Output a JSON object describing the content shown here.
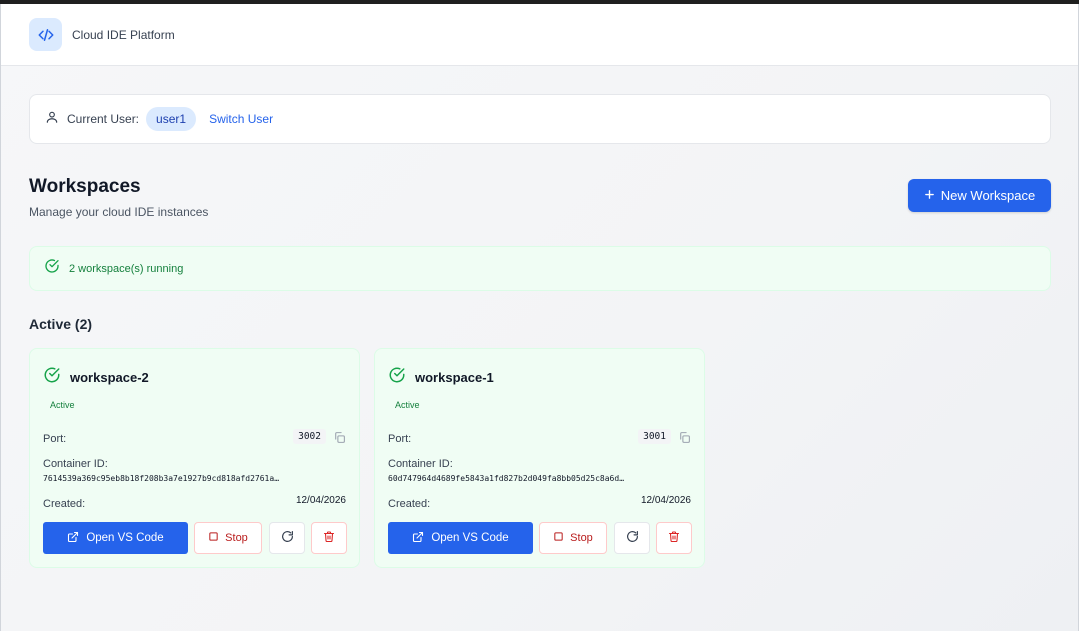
{
  "app": {
    "title": "Cloud IDE Platform",
    "logo_icon": "code-icon"
  },
  "user_bar": {
    "label": "Current User:",
    "username": "user1",
    "switch_label": "Switch User"
  },
  "header": {
    "title": "Workspaces",
    "subtitle": "Manage your cloud IDE instances",
    "new_button": "New Workspace"
  },
  "status": {
    "text": "2 workspace(s) running"
  },
  "section": {
    "title": "Active (2)"
  },
  "labels": {
    "port": "Port:",
    "container_id": "Container ID:",
    "created": "Created:"
  },
  "workspaces": [
    {
      "name": "workspace-2",
      "status": "Active",
      "port": "3002",
      "container_id": "7614539a369c95eb8b18f208b3a7e1927b9cd818afd2761a…",
      "created": "12/04/2026",
      "open_label": "Open VS Code",
      "stop_label": "Stop"
    },
    {
      "name": "workspace-1",
      "status": "Active",
      "port": "3001",
      "container_id": "60d747964d4689fe5843a1fd827b2d049fa8bb05d25c8a6d…",
      "created": "12/04/2026",
      "open_label": "Open VS Code",
      "stop_label": "Stop"
    }
  ],
  "colors": {
    "primary": "#2563eb",
    "success": "#15803d",
    "danger": "#b91c1c"
  }
}
